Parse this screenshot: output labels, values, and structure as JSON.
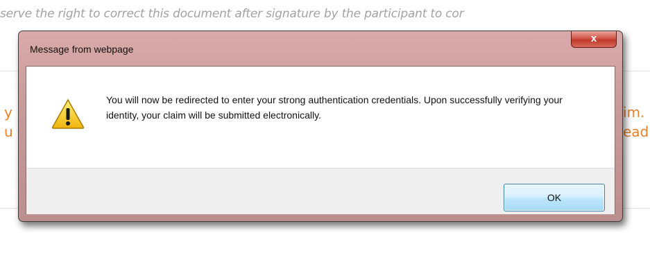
{
  "background_page": {
    "top_line": "serve the right to correct this document after signature by the participant to cor",
    "left_fragment_1": "y",
    "left_fragment_2": "u",
    "right_fragment_1": "im.",
    "right_fragment_2": "eadl",
    "orange_color": "#e8812a"
  },
  "dialog": {
    "title": "Message from webpage",
    "close_label": "x",
    "icon": "warning-icon",
    "message": "You will now be redirected to enter your strong authentication credentials. Upon successfully verifying your identity, your claim will be submitted electronically.",
    "ok_label": "OK",
    "frame_color": "#c89a99",
    "close_color": "#c0392b"
  }
}
